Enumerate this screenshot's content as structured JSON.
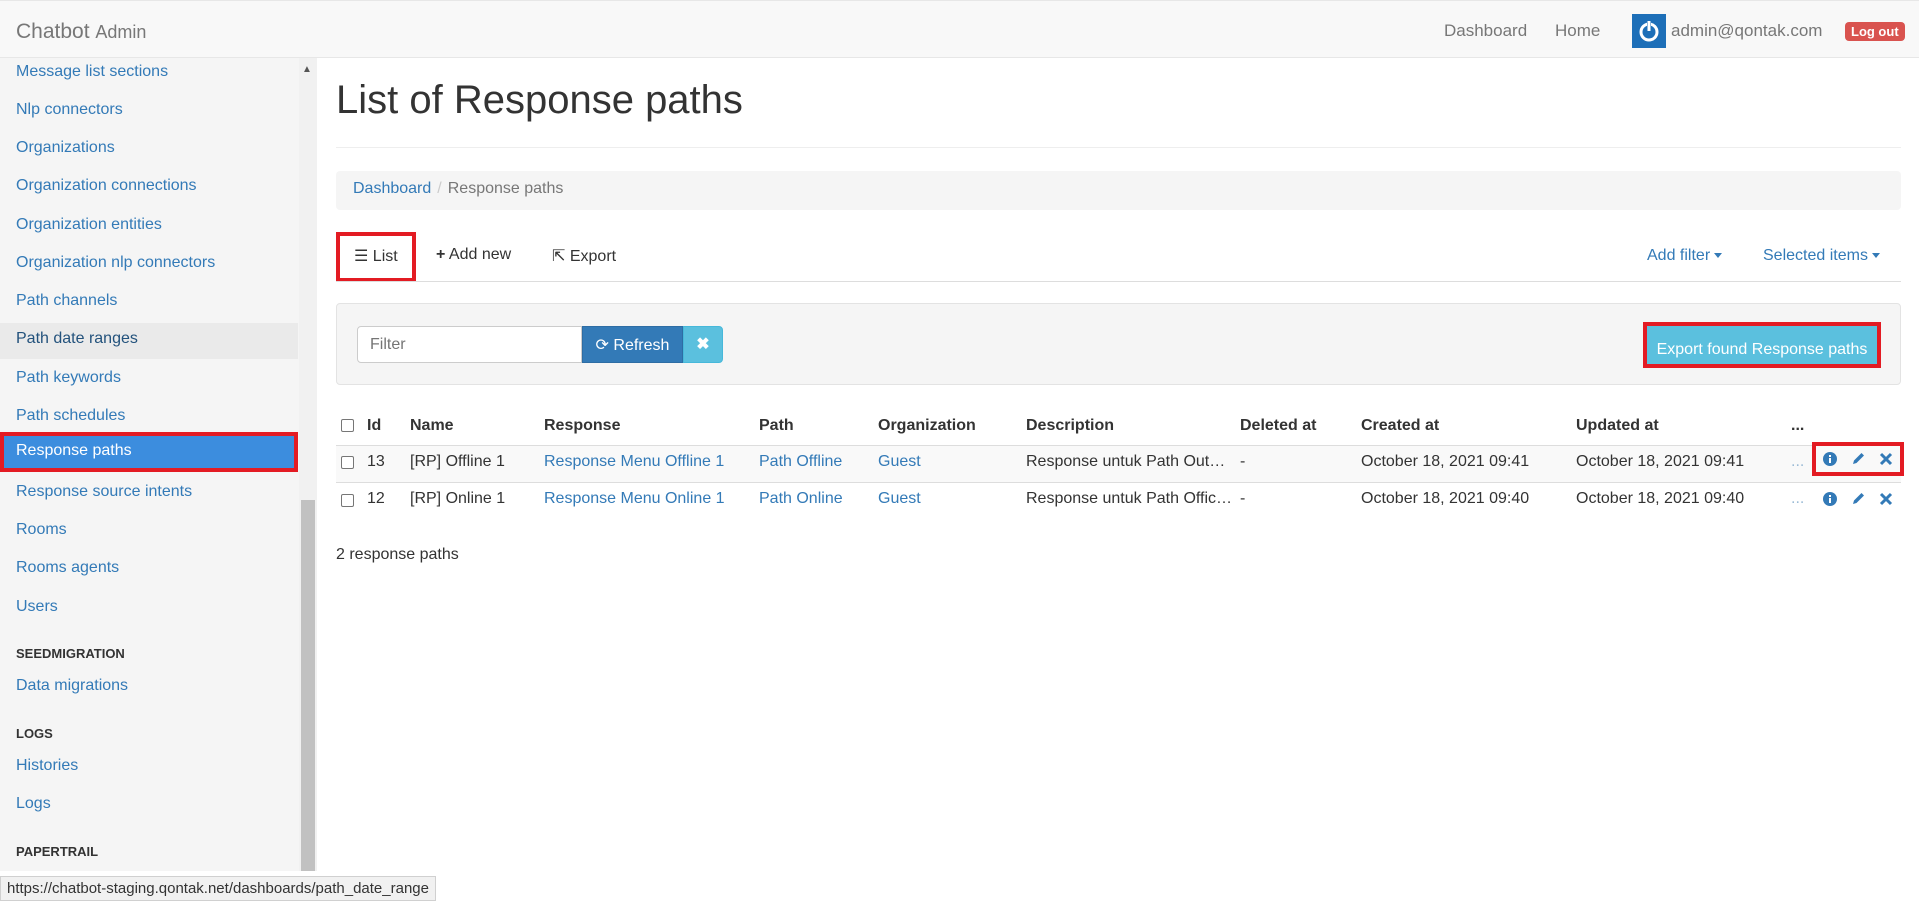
{
  "navbar": {
    "brand": "Chatbot",
    "brand_sub": "Admin",
    "links": [
      "Dashboard",
      "Home"
    ],
    "user": "admin@qontak.com",
    "logout": "Log out"
  },
  "sidebar": {
    "items": [
      {
        "label": "Message list sections"
      },
      {
        "label": "Nlp connectors"
      },
      {
        "label": "Organizations"
      },
      {
        "label": "Organization connections"
      },
      {
        "label": "Organization entities"
      },
      {
        "label": "Organization nlp connectors"
      },
      {
        "label": "Path channels"
      },
      {
        "label": "Path date ranges"
      },
      {
        "label": "Path keywords"
      },
      {
        "label": "Path schedules"
      },
      {
        "label": "Response paths"
      },
      {
        "label": "Response source intents"
      },
      {
        "label": "Rooms"
      },
      {
        "label": "Rooms agents"
      },
      {
        "label": "Users"
      }
    ],
    "sections": [
      {
        "header": "SEEDMIGRATION",
        "items": [
          "Data migrations"
        ]
      },
      {
        "header": "LOGS",
        "items": [
          "Histories",
          "Logs"
        ]
      },
      {
        "header": "PAPERTRAIL",
        "items": []
      }
    ]
  },
  "main": {
    "title": "List of Response paths",
    "breadcrumb": {
      "home": "Dashboard",
      "current": "Response paths"
    },
    "tabs": {
      "list": "List",
      "add_new": "Add new",
      "export": "Export"
    },
    "dropdowns": {
      "add_filter": "Add filter",
      "selected_items": "Selected items"
    },
    "filter": {
      "placeholder": "Filter",
      "refresh": "Refresh"
    },
    "export_found": "Export found Response paths",
    "table": {
      "headers": [
        "Id",
        "Name",
        "Response",
        "Path",
        "Organization",
        "Description",
        "Deleted at",
        "Created at",
        "Updated at",
        "..."
      ],
      "rows": [
        {
          "id": "13",
          "name": "[RP] Offline 1",
          "response": "Response Menu Offline 1",
          "path": "Path Offline",
          "organization": "Guest",
          "description": "Response untuk Path Out…",
          "deleted_at": "-",
          "created_at": "October 18, 2021 09:41",
          "updated_at": "October 18, 2021 09:41",
          "more": "..."
        },
        {
          "id": "12",
          "name": "[RP] Online 1",
          "response": "Response Menu Online 1",
          "path": "Path Online",
          "organization": "Guest",
          "description": "Response untuk Path Offic…",
          "deleted_at": "-",
          "created_at": "October 18, 2021 09:40",
          "updated_at": "October 18, 2021 09:40",
          "more": "..."
        }
      ]
    },
    "count_text": "2 response paths"
  },
  "status_url": "https://chatbot-staging.qontak.net/dashboards/path_date_range"
}
